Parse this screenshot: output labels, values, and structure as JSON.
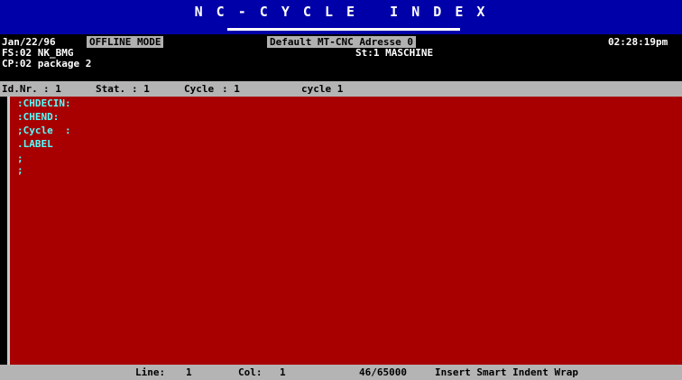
{
  "title": "N C - C Y C L E   I N D E X",
  "header": {
    "date": "Jan/22/96",
    "mode": "OFFLINE MODE",
    "address": "Default MT-CNC Adresse 0",
    "time": "02:28:19pm",
    "fs_line": "FS:02 NK_BMG",
    "station": "St:1 MASCHINE",
    "cp_line": "CP:02 package 2"
  },
  "status": {
    "id_label": "Id.Nr.",
    "id_value": ": 1",
    "stat_label": "Stat.",
    "stat_value": ": 1",
    "cycle_label": "Cycle",
    "cycle_value": ": 1",
    "cycle_name": "cycle 1"
  },
  "editor": {
    "lines": [
      ":CHDECIN:",
      ":CHEND:",
      ";Cycle  :",
      ".LABEL",
      ";",
      ";"
    ]
  },
  "bottom": {
    "line_label": "Line:",
    "line_value": "1",
    "col_label": "Col:",
    "col_value": "1",
    "memory": "46/65000",
    "modes": "Insert Smart Indent Wrap"
  },
  "colors": {
    "title_bg": "#0000a8",
    "editor_bg": "#a80000",
    "editor_text": "#55ffff",
    "status_bg": "#b4b4b4"
  }
}
